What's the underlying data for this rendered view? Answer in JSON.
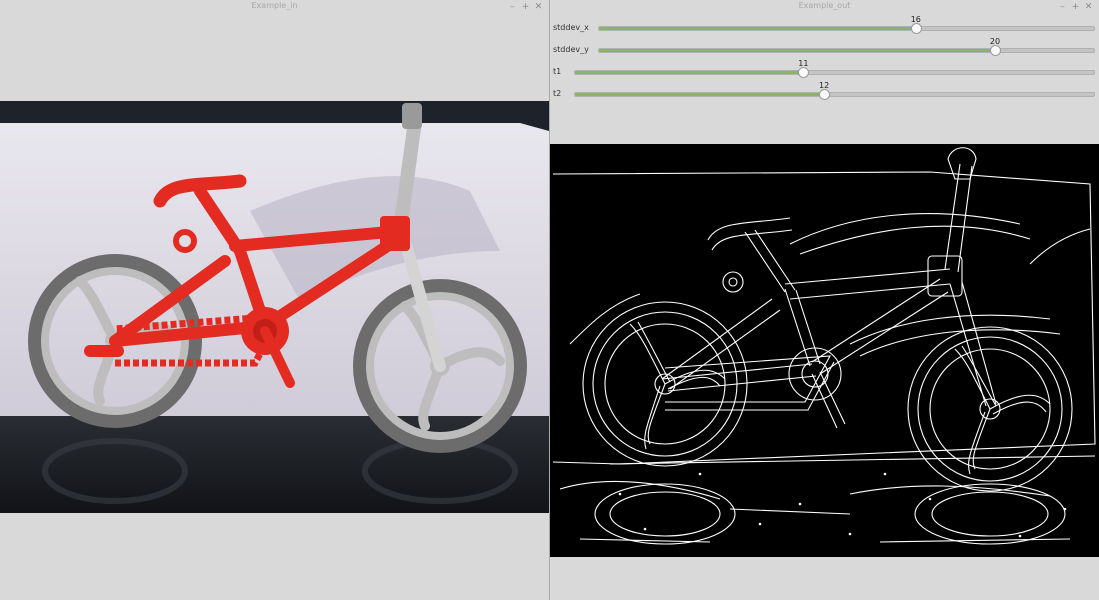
{
  "windows": {
    "input": {
      "title": "Example_in"
    },
    "output": {
      "title": "Example_out"
    }
  },
  "window_controls": {
    "minimize": "–",
    "maximize": "+",
    "close": "✕"
  },
  "trackbars": [
    {
      "label": "stddev_x",
      "value": "16",
      "fraction": 0.64
    },
    {
      "label": "stddev_y",
      "value": "20",
      "fraction": 0.8
    },
    {
      "label": "t1",
      "value": "11",
      "fraction": 0.44
    },
    {
      "label": "t2",
      "value": "12",
      "fraction": 0.48
    }
  ],
  "colors": {
    "accent": "#8cb36c",
    "bike_red": "#e32b22",
    "wheel_gray": "#bdbdbd"
  }
}
